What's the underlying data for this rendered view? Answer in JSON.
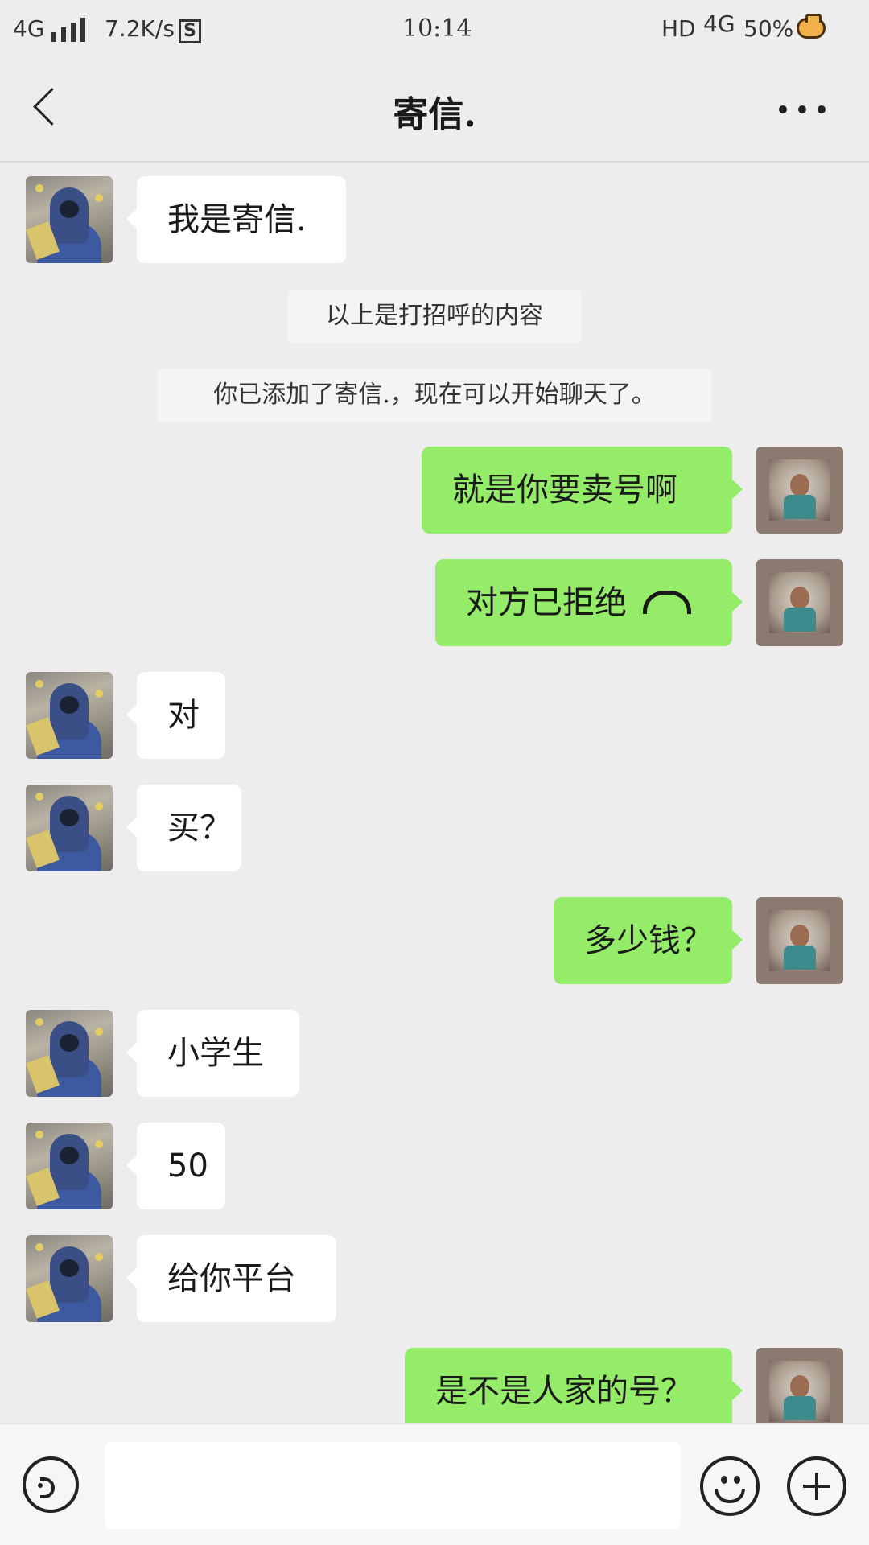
{
  "status_bar": {
    "network": "4G",
    "speed": "7.2K/s",
    "s_icon": "S",
    "time": "10:14",
    "hd": "HD",
    "network_right": "4G",
    "battery": "50%"
  },
  "header": {
    "title": "寄信."
  },
  "messages": [
    {
      "type": "in",
      "text": "我是寄信."
    },
    {
      "type": "system",
      "text": "以上是打招呼的内容"
    },
    {
      "type": "system",
      "text": "你已添加了寄信.，现在可以开始聊天了。"
    },
    {
      "type": "out",
      "text": "就是你要卖号啊"
    },
    {
      "type": "out",
      "text": "对方已拒绝",
      "icon": "phone-hangup-icon"
    },
    {
      "type": "in",
      "text": "对"
    },
    {
      "type": "in",
      "text": "买？"
    },
    {
      "type": "out",
      "text": "多少钱？"
    },
    {
      "type": "in",
      "text": "小学生"
    },
    {
      "type": "in",
      "text": "50"
    },
    {
      "type": "in",
      "text": "给你平台"
    },
    {
      "type": "out",
      "text": "是不是人家的号？"
    }
  ],
  "input_bar": {
    "voice_icon": "voice-icon",
    "emoji_icon": "emoji-icon",
    "plus_icon": "plus-icon",
    "placeholder": ""
  },
  "colors": {
    "background": "#ededed",
    "bubble_out": "#95ec69",
    "bubble_in": "#ffffff"
  }
}
